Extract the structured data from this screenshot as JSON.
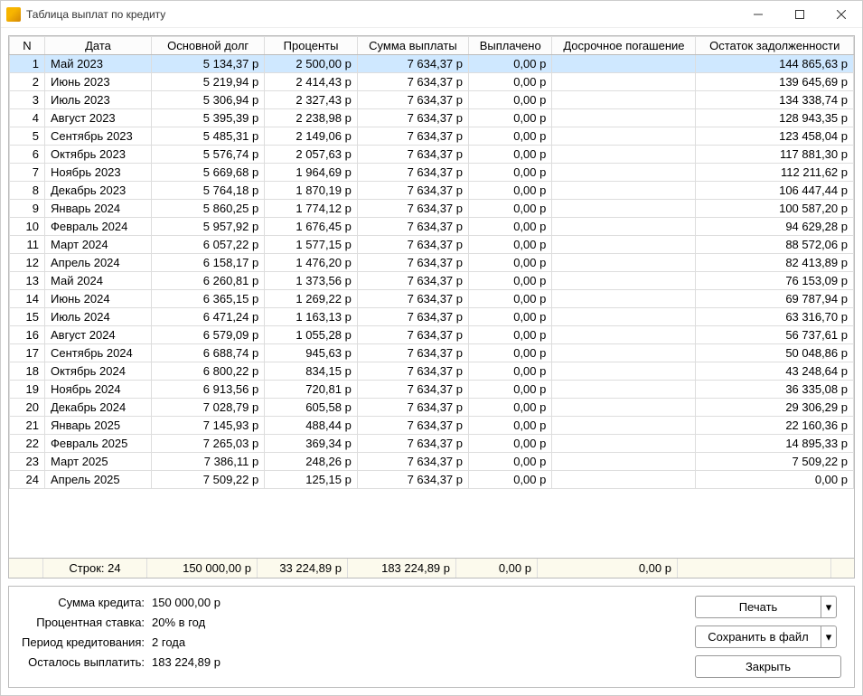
{
  "window": {
    "title": "Таблица выплат по кредиту"
  },
  "table": {
    "headers": {
      "n": "N",
      "date": "Дата",
      "principal": "Основной долг",
      "interest": "Проценты",
      "payment": "Сумма выплаты",
      "paid": "Выплачено",
      "early": "Досрочное погашение",
      "balance": "Остаток задолженности"
    },
    "rows": [
      {
        "n": "1",
        "date": "Май 2023",
        "principal": "5 134,37 р",
        "interest": "2 500,00 р",
        "payment": "7 634,37 р",
        "paid": "0,00 р",
        "early": "",
        "balance": "144 865,63 р"
      },
      {
        "n": "2",
        "date": "Июнь 2023",
        "principal": "5 219,94 р",
        "interest": "2 414,43 р",
        "payment": "7 634,37 р",
        "paid": "0,00 р",
        "early": "",
        "balance": "139 645,69 р"
      },
      {
        "n": "3",
        "date": "Июль 2023",
        "principal": "5 306,94 р",
        "interest": "2 327,43 р",
        "payment": "7 634,37 р",
        "paid": "0,00 р",
        "early": "",
        "balance": "134 338,74 р"
      },
      {
        "n": "4",
        "date": "Август 2023",
        "principal": "5 395,39 р",
        "interest": "2 238,98 р",
        "payment": "7 634,37 р",
        "paid": "0,00 р",
        "early": "",
        "balance": "128 943,35 р"
      },
      {
        "n": "5",
        "date": "Сентябрь 2023",
        "principal": "5 485,31 р",
        "interest": "2 149,06 р",
        "payment": "7 634,37 р",
        "paid": "0,00 р",
        "early": "",
        "balance": "123 458,04 р"
      },
      {
        "n": "6",
        "date": "Октябрь 2023",
        "principal": "5 576,74 р",
        "interest": "2 057,63 р",
        "payment": "7 634,37 р",
        "paid": "0,00 р",
        "early": "",
        "balance": "117 881,30 р"
      },
      {
        "n": "7",
        "date": "Ноябрь 2023",
        "principal": "5 669,68 р",
        "interest": "1 964,69 р",
        "payment": "7 634,37 р",
        "paid": "0,00 р",
        "early": "",
        "balance": "112 211,62 р"
      },
      {
        "n": "8",
        "date": "Декабрь 2023",
        "principal": "5 764,18 р",
        "interest": "1 870,19 р",
        "payment": "7 634,37 р",
        "paid": "0,00 р",
        "early": "",
        "balance": "106 447,44 р"
      },
      {
        "n": "9",
        "date": "Январь 2024",
        "principal": "5 860,25 р",
        "interest": "1 774,12 р",
        "payment": "7 634,37 р",
        "paid": "0,00 р",
        "early": "",
        "balance": "100 587,20 р"
      },
      {
        "n": "10",
        "date": "Февраль 2024",
        "principal": "5 957,92 р",
        "interest": "1 676,45 р",
        "payment": "7 634,37 р",
        "paid": "0,00 р",
        "early": "",
        "balance": "94 629,28 р"
      },
      {
        "n": "11",
        "date": "Март 2024",
        "principal": "6 057,22 р",
        "interest": "1 577,15 р",
        "payment": "7 634,37 р",
        "paid": "0,00 р",
        "early": "",
        "balance": "88 572,06 р"
      },
      {
        "n": "12",
        "date": "Апрель 2024",
        "principal": "6 158,17 р",
        "interest": "1 476,20 р",
        "payment": "7 634,37 р",
        "paid": "0,00 р",
        "early": "",
        "balance": "82 413,89 р"
      },
      {
        "n": "13",
        "date": "Май 2024",
        "principal": "6 260,81 р",
        "interest": "1 373,56 р",
        "payment": "7 634,37 р",
        "paid": "0,00 р",
        "early": "",
        "balance": "76 153,09 р"
      },
      {
        "n": "14",
        "date": "Июнь 2024",
        "principal": "6 365,15 р",
        "interest": "1 269,22 р",
        "payment": "7 634,37 р",
        "paid": "0,00 р",
        "early": "",
        "balance": "69 787,94 р"
      },
      {
        "n": "15",
        "date": "Июль 2024",
        "principal": "6 471,24 р",
        "interest": "1 163,13 р",
        "payment": "7 634,37 р",
        "paid": "0,00 р",
        "early": "",
        "balance": "63 316,70 р"
      },
      {
        "n": "16",
        "date": "Август 2024",
        "principal": "6 579,09 р",
        "interest": "1 055,28 р",
        "payment": "7 634,37 р",
        "paid": "0,00 р",
        "early": "",
        "balance": "56 737,61 р"
      },
      {
        "n": "17",
        "date": "Сентябрь 2024",
        "principal": "6 688,74 р",
        "interest": "945,63 р",
        "payment": "7 634,37 р",
        "paid": "0,00 р",
        "early": "",
        "balance": "50 048,86 р"
      },
      {
        "n": "18",
        "date": "Октябрь 2024",
        "principal": "6 800,22 р",
        "interest": "834,15 р",
        "payment": "7 634,37 р",
        "paid": "0,00 р",
        "early": "",
        "balance": "43 248,64 р"
      },
      {
        "n": "19",
        "date": "Ноябрь 2024",
        "principal": "6 913,56 р",
        "interest": "720,81 р",
        "payment": "7 634,37 р",
        "paid": "0,00 р",
        "early": "",
        "balance": "36 335,08 р"
      },
      {
        "n": "20",
        "date": "Декабрь 2024",
        "principal": "7 028,79 р",
        "interest": "605,58 р",
        "payment": "7 634,37 р",
        "paid": "0,00 р",
        "early": "",
        "balance": "29 306,29 р"
      },
      {
        "n": "21",
        "date": "Январь 2025",
        "principal": "7 145,93 р",
        "interest": "488,44 р",
        "payment": "7 634,37 р",
        "paid": "0,00 р",
        "early": "",
        "balance": "22 160,36 р"
      },
      {
        "n": "22",
        "date": "Февраль 2025",
        "principal": "7 265,03 р",
        "interest": "369,34 р",
        "payment": "7 634,37 р",
        "paid": "0,00 р",
        "early": "",
        "balance": "14 895,33 р"
      },
      {
        "n": "23",
        "date": "Март 2025",
        "principal": "7 386,11 р",
        "interest": "248,26 р",
        "payment": "7 634,37 р",
        "paid": "0,00 р",
        "early": "",
        "balance": "7 509,22 р"
      },
      {
        "n": "24",
        "date": "Апрель 2025",
        "principal": "7 509,22 р",
        "interest": "125,15 р",
        "payment": "7 634,37 р",
        "paid": "0,00 р",
        "early": "",
        "balance": "0,00 р"
      }
    ],
    "summary": {
      "rowcount_label": "Строк: 24",
      "principal": "150 000,00 р",
      "interest": "33 224,89 р",
      "payment": "183 224,89 р",
      "paid": "0,00 р",
      "early": "0,00 р",
      "balance": ""
    }
  },
  "info": {
    "amount_label": "Сумма кредита:",
    "amount_value": "150 000,00 р",
    "rate_label": "Процентная ставка:",
    "rate_value": "20% в год",
    "period_label": "Период кредитования:",
    "period_value": "2 года",
    "remaining_label": "Осталось выплатить:",
    "remaining_value": "183 224,89 р"
  },
  "buttons": {
    "print": "Печать",
    "save": "Сохранить в файл",
    "close": "Закрыть",
    "arrow": "▾"
  }
}
